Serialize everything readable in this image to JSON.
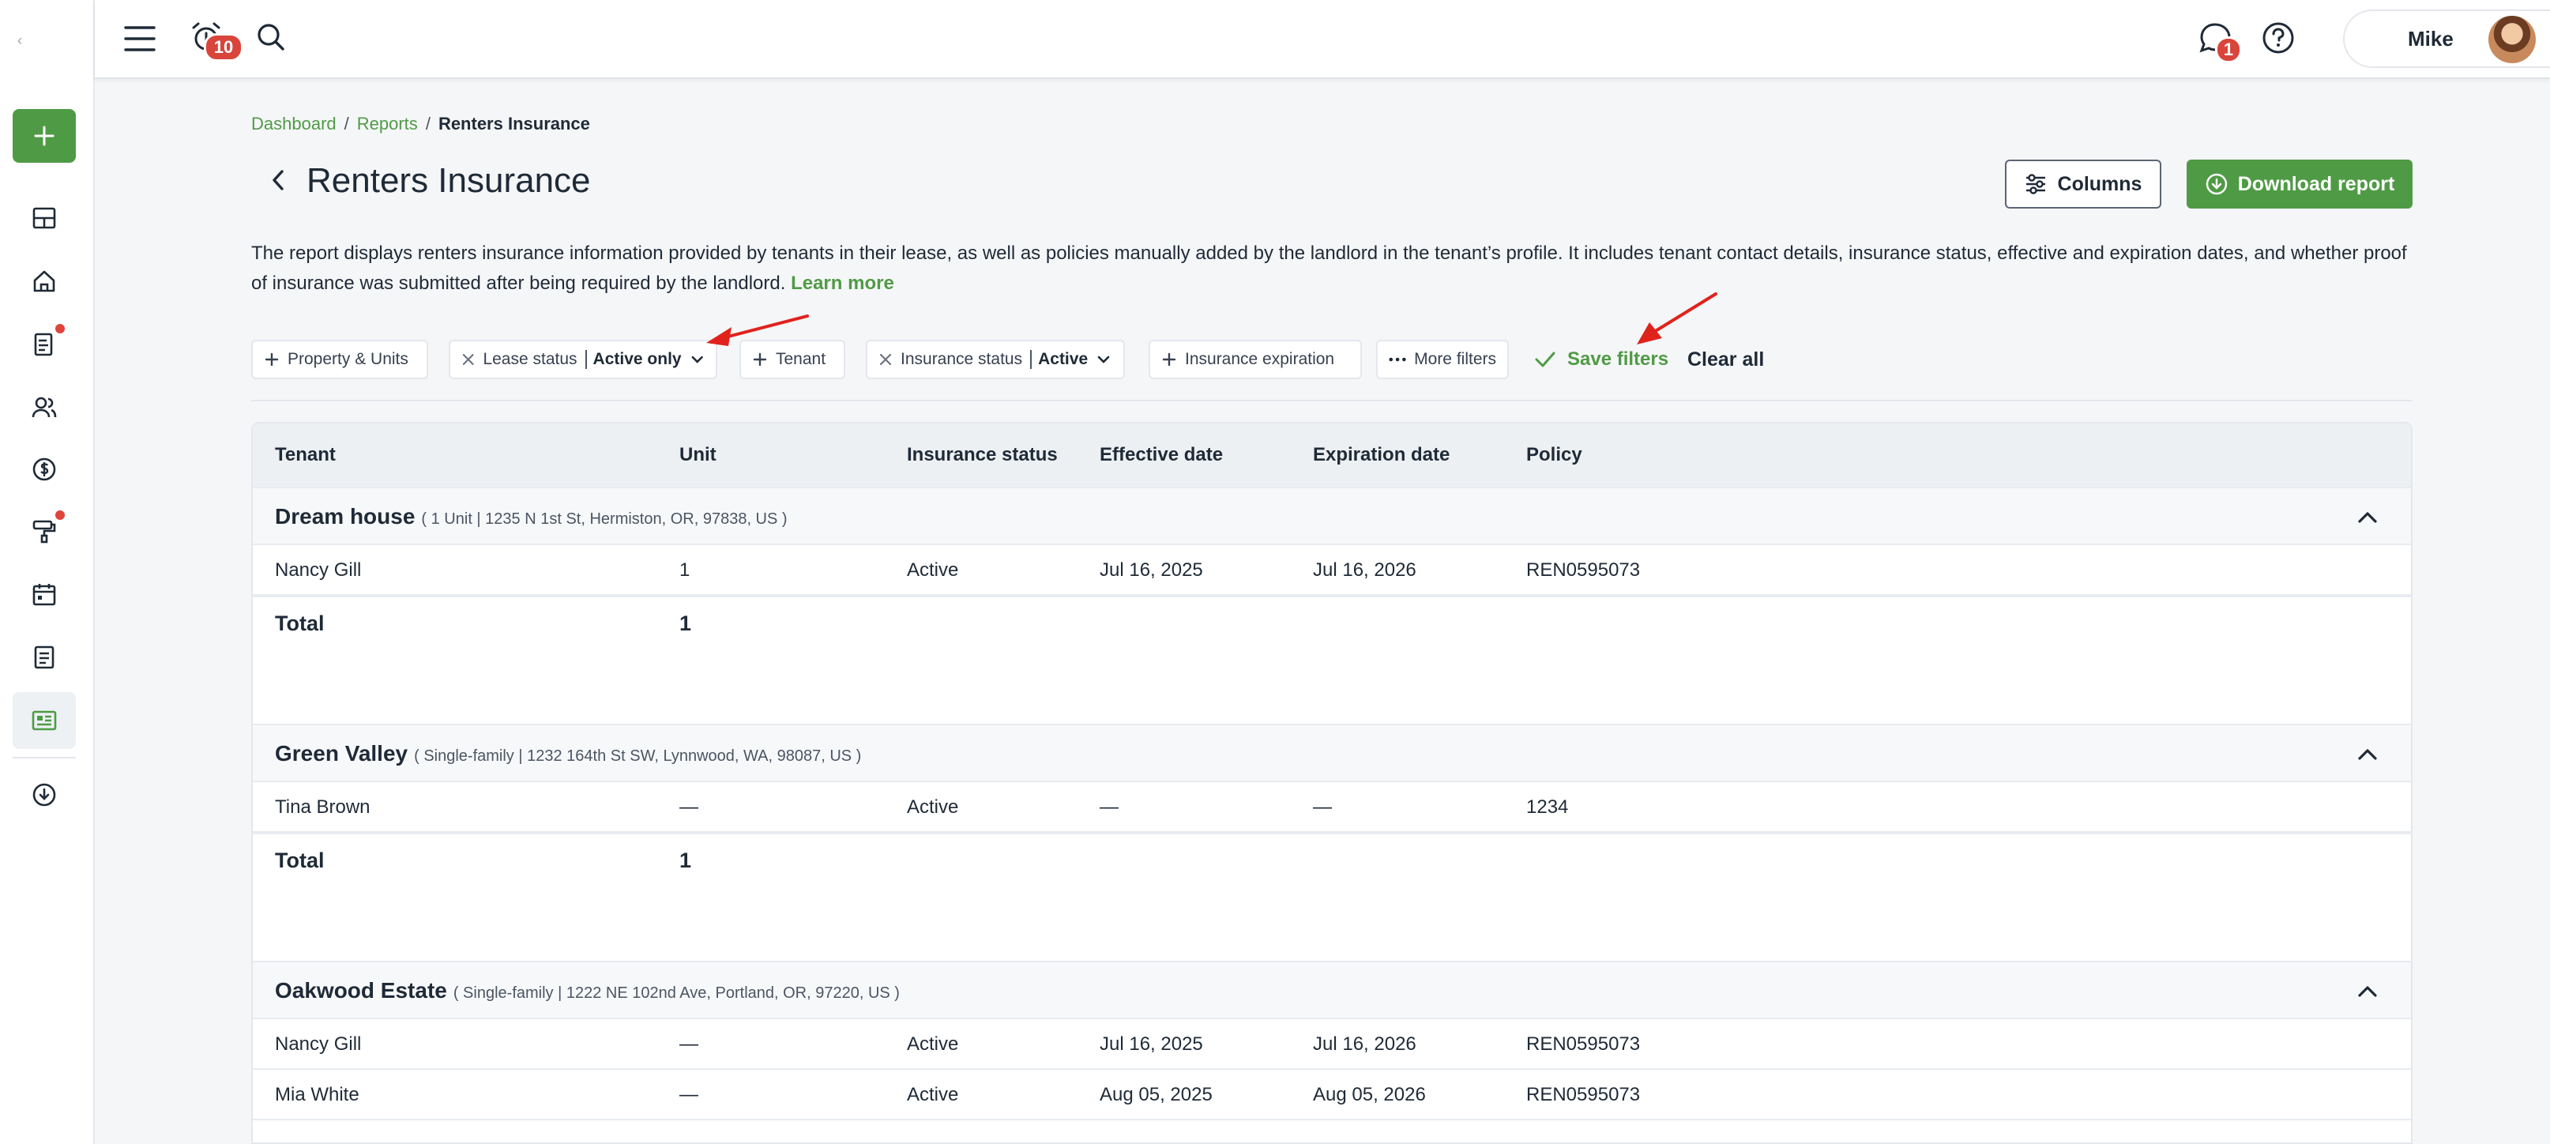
{
  "topbar": {
    "notifications_count": "10",
    "messages_count": "1",
    "user_name": "Mike"
  },
  "breadcrumb": {
    "items": [
      "Dashboard",
      "Reports"
    ],
    "current": "Renters Insurance",
    "separator": "/"
  },
  "page": {
    "title": "Renters Insurance",
    "columns_label": "Columns",
    "download_label": "Download report",
    "description": "The report displays renters insurance information provided by tenants in their lease, as well as policies manually added by the landlord in the tenant’s profile. It includes tenant contact details, insurance status, effective and expiration dates, and whether proof of insurance was submitted after being required by the landlord.",
    "learn_more": "Learn more"
  },
  "filters": {
    "property_units": "Property & Units",
    "lease_status_label": "Lease status",
    "lease_status_value": "Active only",
    "tenant": "Tenant",
    "insurance_status_label": "Insurance status",
    "insurance_status_value": "Active",
    "insurance_expiration": "Insurance expiration",
    "more_filters": "More filters",
    "save_filters": "Save filters",
    "clear_all": "Clear all"
  },
  "table": {
    "headers": [
      "Tenant",
      "Unit",
      "Insurance status",
      "Effective date",
      "Expiration date",
      "Policy"
    ],
    "total_label": "Total",
    "groups": [
      {
        "name": "Dream house",
        "address": "( 1 Unit | 1235 N 1st St, Hermiston, OR, 97838, US )",
        "rows": [
          {
            "tenant": "Nancy Gill",
            "unit": "1",
            "status": "Active",
            "effective": "Jul 16, 2025",
            "expiration": "Jul 16, 2026",
            "policy": "REN0595073"
          }
        ],
        "total": "1"
      },
      {
        "name": "Green Valley",
        "address": "( Single-family | 1232 164th St SW, Lynnwood, WA, 98087, US )",
        "rows": [
          {
            "tenant": "Tina Brown",
            "unit": "—",
            "status": "Active",
            "effective": "—",
            "expiration": "—",
            "policy": "1234"
          }
        ],
        "total": "1"
      },
      {
        "name": "Oakwood Estate",
        "address": "( Single-family | 1222 NE 102nd Ave, Portland, OR, 97220, US )",
        "rows": [
          {
            "tenant": "Nancy Gill",
            "unit": "—",
            "status": "Active",
            "effective": "Jul 16, 2025",
            "expiration": "Jul 16, 2026",
            "policy": "REN0595073"
          },
          {
            "tenant": "Mia White",
            "unit": "—",
            "status": "Active",
            "effective": "Aug 05, 2025",
            "expiration": "Aug 05, 2026",
            "policy": "REN0595073"
          }
        ]
      }
    ]
  },
  "sidebar": {
    "items": [
      "dashboard-icon",
      "home-icon",
      "document-icon",
      "people-icon",
      "dollar-icon",
      "paint-roller-icon",
      "calendar-icon",
      "notes-icon",
      "reports-icon",
      "download-cloud-icon"
    ]
  },
  "colors": {
    "brand_green": "#4f9b45",
    "badge_red": "#d9443b",
    "annotation_arrow": "#e0221c"
  }
}
